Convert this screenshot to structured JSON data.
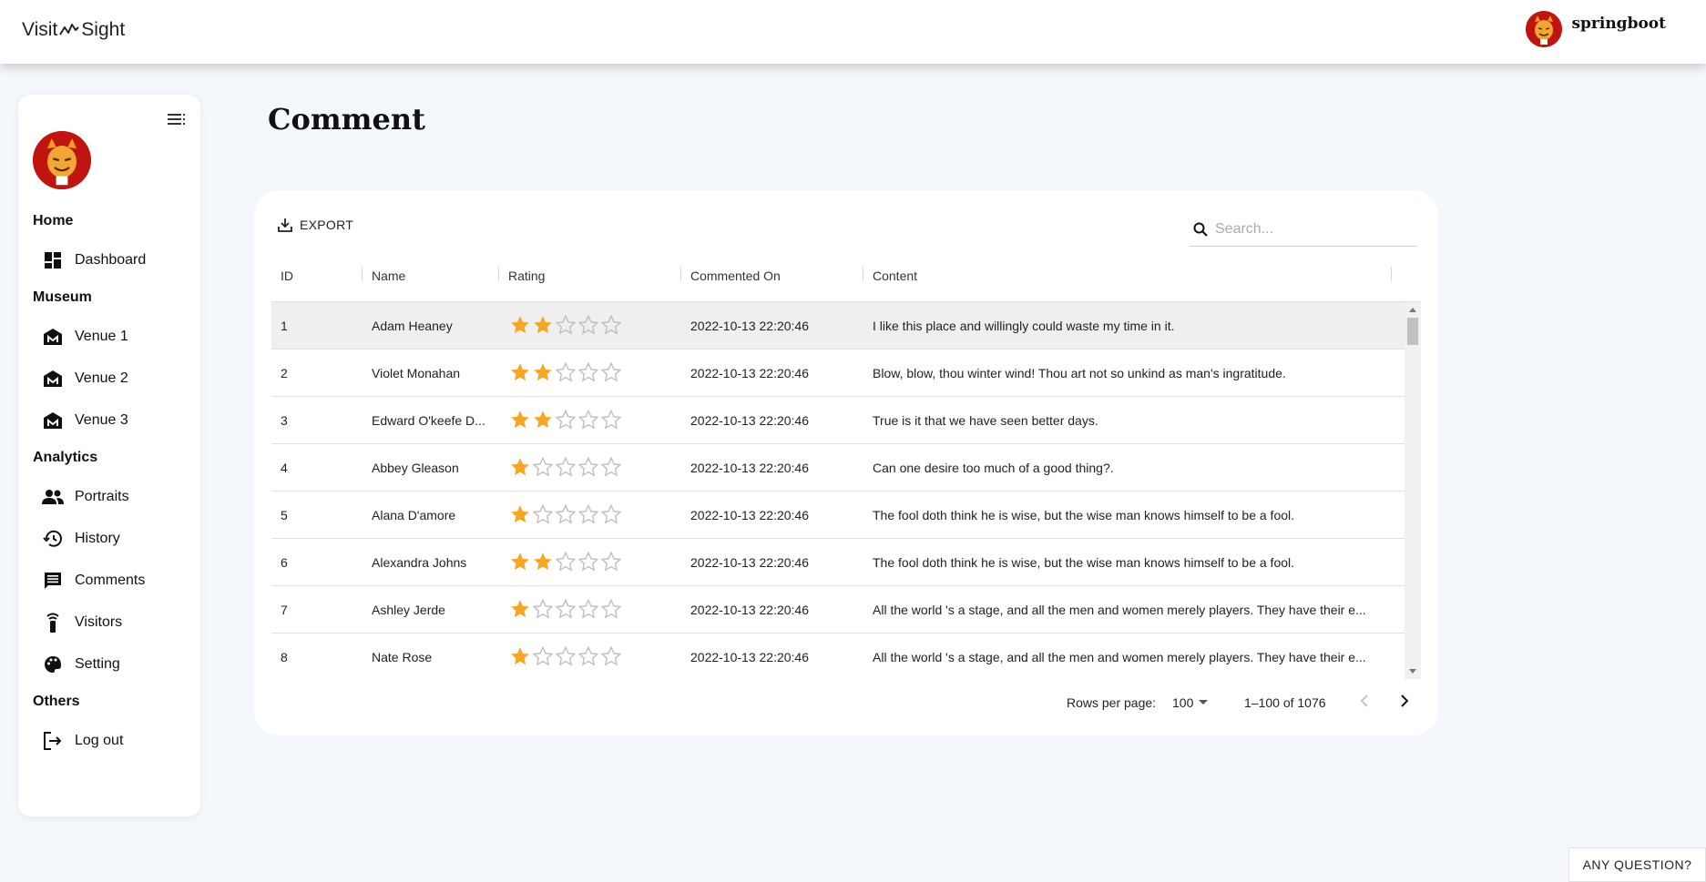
{
  "brand": {
    "part1": "Visit",
    "part2": "Sight"
  },
  "user": {
    "name": "springboot"
  },
  "sidebar": {
    "sections": [
      {
        "title": "Home",
        "items": [
          {
            "label": "Dashboard",
            "icon": "dashboard-icon"
          }
        ]
      },
      {
        "title": "Museum",
        "items": [
          {
            "label": "Venue 1",
            "icon": "museum-icon"
          },
          {
            "label": "Venue 2",
            "icon": "museum-icon"
          },
          {
            "label": "Venue 3",
            "icon": "museum-icon"
          }
        ]
      },
      {
        "title": "Analytics",
        "items": [
          {
            "label": "Portraits",
            "icon": "people-icon"
          },
          {
            "label": "History",
            "icon": "history-icon"
          },
          {
            "label": "Comments",
            "icon": "comment-icon"
          },
          {
            "label": "Visitors",
            "icon": "visitor-icon"
          },
          {
            "label": "Setting",
            "icon": "palette-icon"
          }
        ]
      },
      {
        "title": "Others",
        "items": [
          {
            "label": "Log out",
            "icon": "logout-icon"
          }
        ]
      }
    ]
  },
  "page": {
    "title": "Comment"
  },
  "toolbar": {
    "export_label": "EXPORT",
    "search_placeholder": "Search..."
  },
  "table": {
    "columns": [
      "ID",
      "Name",
      "Rating",
      "Commented On",
      "Content"
    ],
    "rows": [
      {
        "id": "1",
        "name": "Adam Heaney",
        "rating": 2,
        "date": "2022-10-13 22:20:46",
        "content": "I like this place and willingly could waste my time in it."
      },
      {
        "id": "2",
        "name": "Violet Monahan",
        "rating": 2,
        "date": "2022-10-13 22:20:46",
        "content": "Blow, blow, thou winter wind! Thou art not so unkind as man's ingratitude."
      },
      {
        "id": "3",
        "name": "Edward O'keefe D...",
        "rating": 2,
        "date": "2022-10-13 22:20:46",
        "content": "True is it that we have seen better days."
      },
      {
        "id": "4",
        "name": "Abbey Gleason",
        "rating": 1,
        "date": "2022-10-13 22:20:46",
        "content": "Can one desire too much of a good thing?."
      },
      {
        "id": "5",
        "name": "Alana D'amore",
        "rating": 1,
        "date": "2022-10-13 22:20:46",
        "content": "The fool doth think he is wise, but the wise man knows himself to be a fool."
      },
      {
        "id": "6",
        "name": "Alexandra Johns",
        "rating": 2,
        "date": "2022-10-13 22:20:46",
        "content": "The fool doth think he is wise, but the wise man knows himself to be a fool."
      },
      {
        "id": "7",
        "name": "Ashley Jerde",
        "rating": 1,
        "date": "2022-10-13 22:20:46",
        "content": "All the world 's a stage, and all the men and women merely players. They have their e..."
      },
      {
        "id": "8",
        "name": "Nate Rose",
        "rating": 1,
        "date": "2022-10-13 22:20:46",
        "content": "All the world 's a stage, and all the men and women merely players. They have their e..."
      }
    ],
    "max_rating": 5
  },
  "pagination": {
    "rows_per_page_label": "Rows per page:",
    "rows_per_page": "100",
    "range": "1–100 of 1076"
  },
  "help": {
    "label": "ANY QUESTION?"
  },
  "colors": {
    "star_filled": "#f5a623",
    "star_empty": "#bdbdbd",
    "avatar_bg": "#c0140f"
  }
}
